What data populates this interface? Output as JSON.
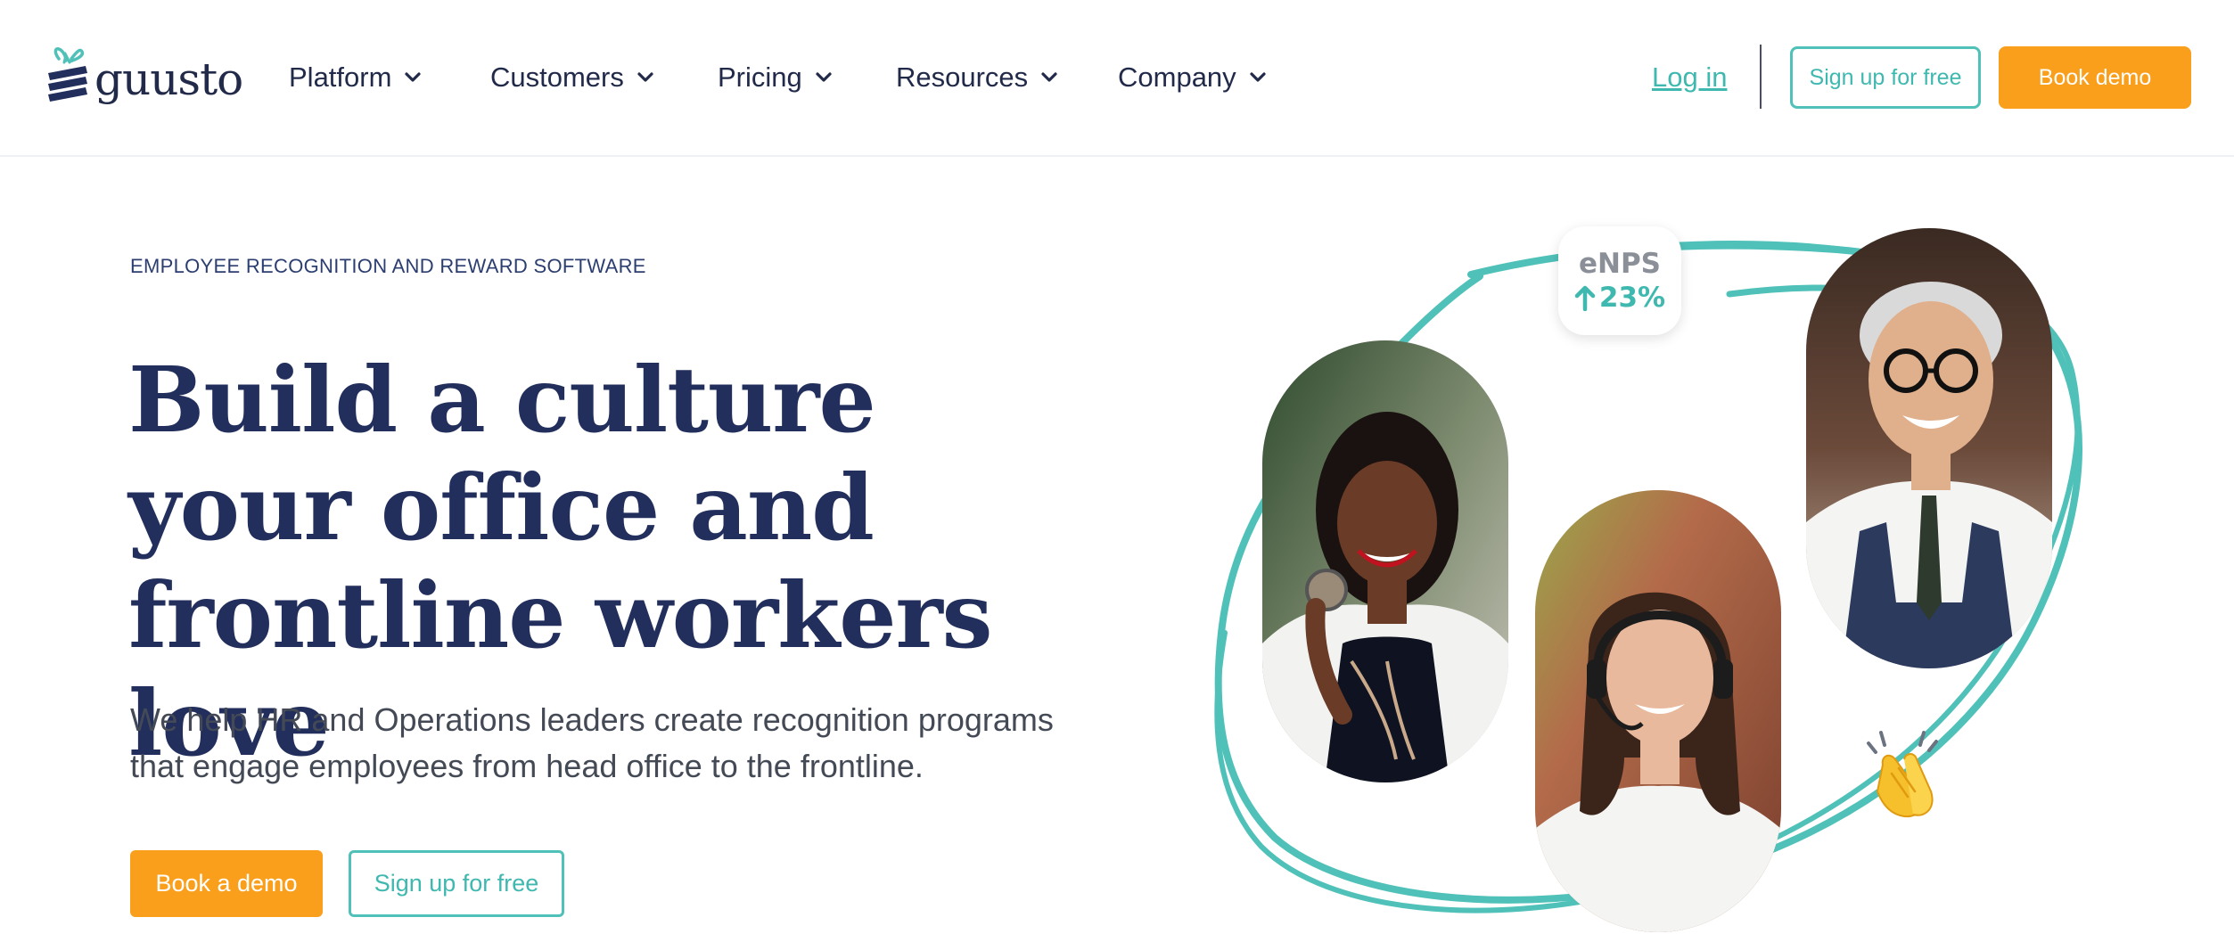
{
  "brand": {
    "name": "guusto",
    "primary": "#222f5d",
    "accent_teal": "#4fc1b9",
    "accent_orange": "#fa9f1b"
  },
  "nav": {
    "items": [
      {
        "label": "Platform",
        "icon": "chevron-down-icon"
      },
      {
        "label": "Customers",
        "icon": "chevron-down-icon"
      },
      {
        "label": "Pricing",
        "icon": "chevron-down-icon"
      },
      {
        "label": "Resources",
        "icon": "chevron-down-icon"
      },
      {
        "label": "Company",
        "icon": "chevron-down-icon"
      }
    ],
    "login_label": "Log in",
    "signup_label": "Sign up for free",
    "demo_label": "Book demo"
  },
  "hero": {
    "eyebrow": "EMPLOYEE RECOGNITION AND REWARD SOFTWARE",
    "headline": "Build a culture your office and frontline workers love",
    "subtitle": "We help HR and Operations leaders create recognition programs that engage employees from head office to the frontline.",
    "primary_cta": "Book a demo",
    "secondary_cta": "Sign up for free"
  },
  "illustration": {
    "stat_label": "eNPS",
    "stat_value": "23%",
    "stat_icon": "arrow-up-icon",
    "emoji_icon": "clapping-hands-icon"
  }
}
